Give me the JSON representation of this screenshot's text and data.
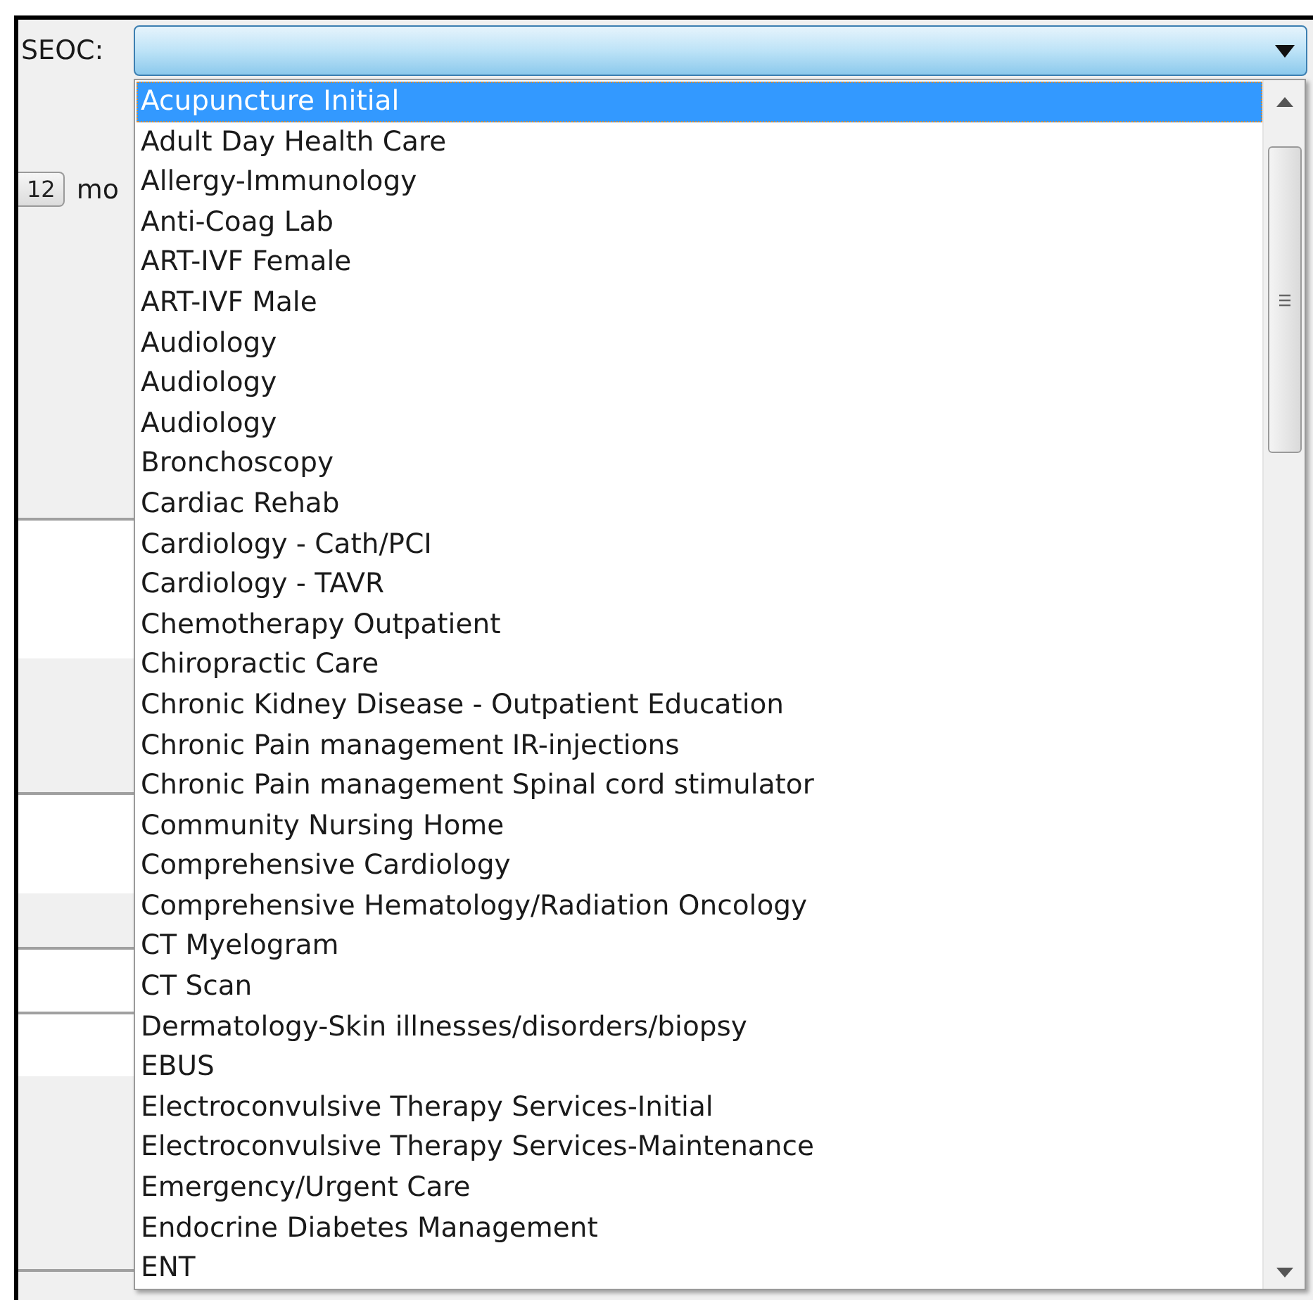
{
  "field": {
    "label": "SEOC:"
  },
  "background": {
    "spin_value": "12",
    "unit_label": "mo"
  },
  "options": [
    {
      "label": "Acupuncture Initial",
      "selected": true
    },
    {
      "label": "Adult Day Health Care",
      "selected": false
    },
    {
      "label": "Allergy-Immunology",
      "selected": false
    },
    {
      "label": "Anti-Coag Lab",
      "selected": false
    },
    {
      "label": "ART-IVF Female",
      "selected": false
    },
    {
      "label": "ART-IVF Male",
      "selected": false
    },
    {
      "label": "Audiology",
      "selected": false
    },
    {
      "label": "Audiology",
      "selected": false
    },
    {
      "label": "Audiology",
      "selected": false
    },
    {
      "label": "Bronchoscopy",
      "selected": false
    },
    {
      "label": "Cardiac Rehab",
      "selected": false
    },
    {
      "label": "Cardiology - Cath/PCI",
      "selected": false
    },
    {
      "label": "Cardiology - TAVR",
      "selected": false
    },
    {
      "label": "Chemotherapy Outpatient",
      "selected": false
    },
    {
      "label": "Chiropractic Care",
      "selected": false
    },
    {
      "label": "Chronic Kidney Disease - Outpatient Education",
      "selected": false
    },
    {
      "label": "Chronic Pain management IR-injections",
      "selected": false
    },
    {
      "label": "Chronic Pain management Spinal cord stimulator",
      "selected": false
    },
    {
      "label": "Community Nursing Home",
      "selected": false
    },
    {
      "label": "Comprehensive Cardiology",
      "selected": false
    },
    {
      "label": "Comprehensive Hematology/Radiation Oncology",
      "selected": false
    },
    {
      "label": "CT Myelogram",
      "selected": false
    },
    {
      "label": "CT Scan",
      "selected": false
    },
    {
      "label": "Dermatology-Skin illnesses/disorders/biopsy",
      "selected": false
    },
    {
      "label": "EBUS",
      "selected": false
    },
    {
      "label": "Electroconvulsive Therapy Services-Initial",
      "selected": false
    },
    {
      "label": "Electroconvulsive Therapy Services-Maintenance",
      "selected": false
    },
    {
      "label": "Emergency/Urgent Care",
      "selected": false
    },
    {
      "label": "Endocrine Diabetes Management",
      "selected": false
    },
    {
      "label": "ENT",
      "selected": false
    }
  ]
}
